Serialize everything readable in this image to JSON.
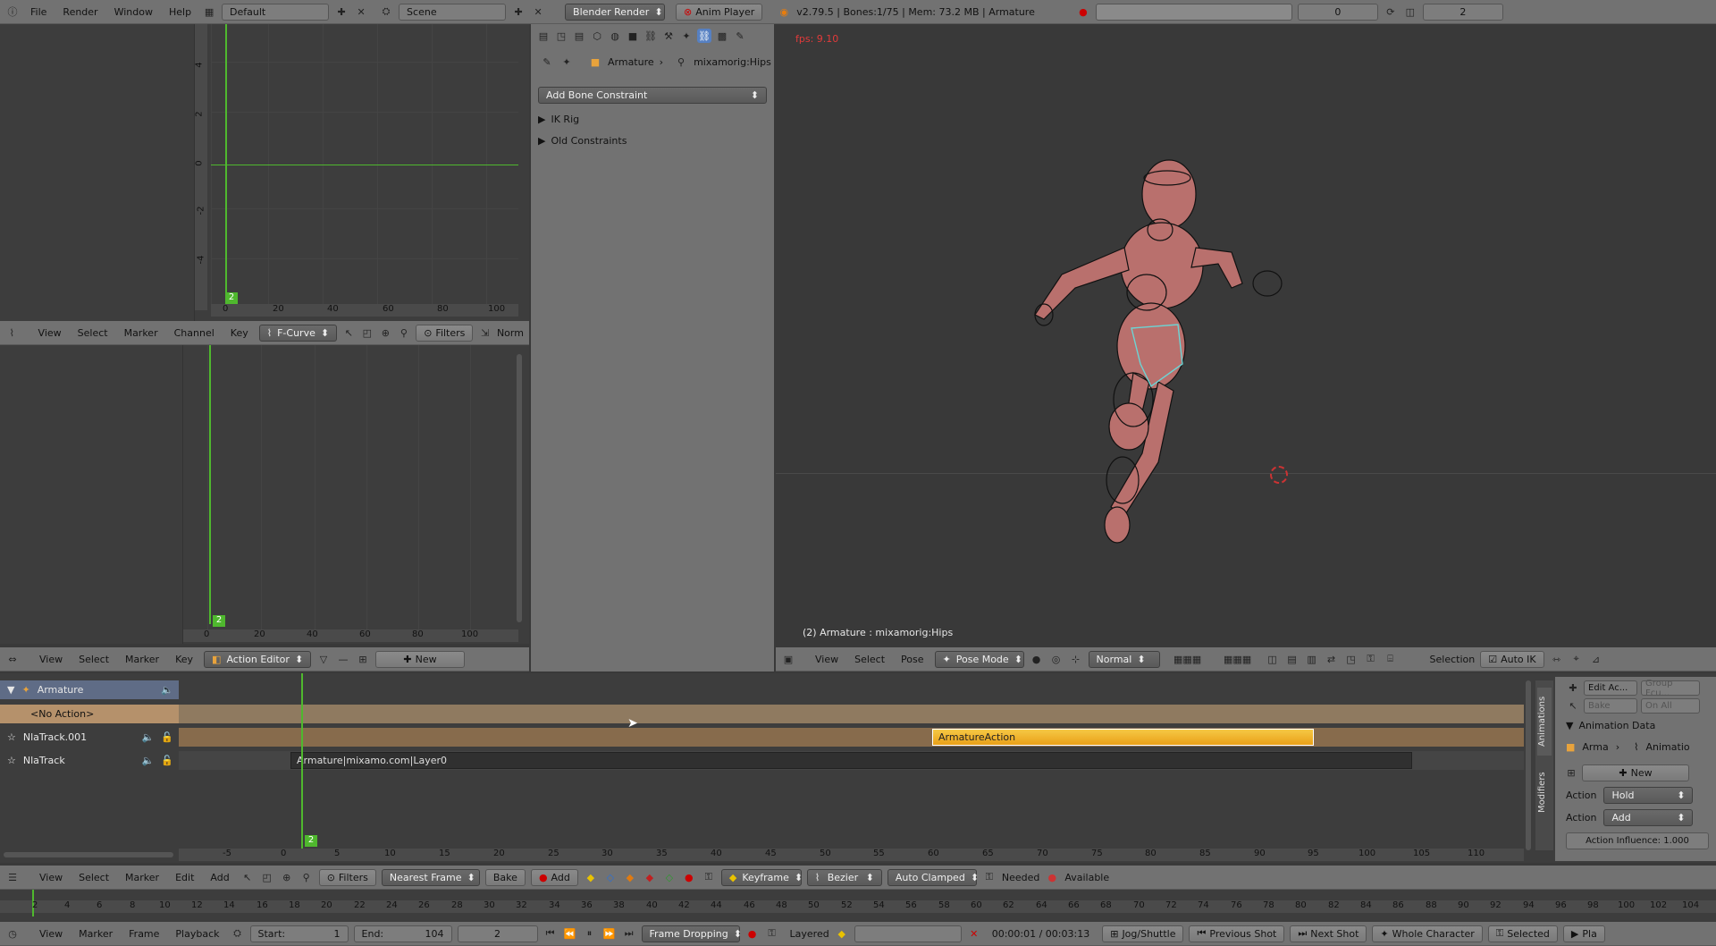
{
  "info_header": {
    "menus": [
      "File",
      "Render",
      "Window",
      "Help"
    ],
    "layout": "Default",
    "scene": "Scene",
    "engine": "Blender Render",
    "anim_player": "Anim Player",
    "stats": "v2.79.5 | Bones:1/75 | Mem: 73.2 MB | Armature",
    "frame_a": "0",
    "frame_b": "2"
  },
  "graph_editor": {
    "menus": [
      "View",
      "Select",
      "Marker",
      "Channel",
      "Key"
    ],
    "mode": "F-Curve",
    "filters": "Filters",
    "normalize": "Norm",
    "y_ticks": [
      "4",
      "2",
      "0",
      "-2",
      "-4"
    ],
    "x_ticks": [
      "0",
      "20",
      "40",
      "60",
      "80",
      "100"
    ],
    "frame_marker": "2"
  },
  "dope_sheet": {
    "menus": [
      "View",
      "Select",
      "Marker",
      "Key"
    ],
    "mode": "Action Editor",
    "new_label": "New",
    "x_ticks": [
      "0",
      "20",
      "40",
      "60",
      "80",
      "100"
    ],
    "frame_marker": "2"
  },
  "properties": {
    "breadcrumb_obj": "Armature",
    "breadcrumb_bone": "mixamorig:Hips",
    "add_constraint": "Add Bone Constraint",
    "panels": [
      "IK Rig",
      "Old Constraints"
    ]
  },
  "viewport": {
    "fps": "fps: 9.10",
    "status": "(2) Armature : mixamorig:Hips",
    "menus": [
      "View",
      "Select",
      "Pose"
    ],
    "mode": "Pose Mode",
    "orientation": "Normal",
    "selection": "Selection",
    "auto_ik": "Auto IK"
  },
  "nla": {
    "channels": [
      {
        "name": "Armature"
      },
      {
        "name": "<No Action>"
      },
      {
        "name": "NlaTrack.001"
      },
      {
        "name": "NlaTrack"
      }
    ],
    "strip_action": "ArmatureAction",
    "strip_layer": "Armature|mixamo.com|Layer0",
    "x_ticks": [
      "-5",
      "0",
      "5",
      "10",
      "15",
      "20",
      "25",
      "30",
      "35",
      "40",
      "45",
      "50",
      "55",
      "60",
      "65",
      "70",
      "75",
      "80",
      "85",
      "90",
      "95",
      "100",
      "105",
      "110"
    ],
    "frame_marker": "2",
    "menus": [
      "View",
      "Select",
      "Marker",
      "Edit",
      "Add"
    ],
    "filters": "Filters",
    "snap": "Nearest Frame",
    "bake": "Bake",
    "add": "Add",
    "keyframe": "Keyframe",
    "interp": "Bezier",
    "handle": "Auto Clamped",
    "needed": "Needed",
    "available": "Available",
    "side_tabs": [
      "Animations",
      "Modifiers"
    ],
    "side": {
      "edit_action": "Edit Ac...",
      "group_fcu": "Group Fcu...",
      "bake": "Bake",
      "on_all": "On All",
      "panel_title": "Animation Data",
      "arma": "Arma",
      "animatio": "Animatio",
      "new": "New",
      "action_label": "Action",
      "hold": "Hold",
      "action_label2": "Action",
      "add": "Add",
      "influence": "Action Influence: 1.000"
    }
  },
  "timeline": {
    "ticks": [
      "2",
      "4",
      "6",
      "8",
      "10",
      "12",
      "14",
      "16",
      "18",
      "20",
      "22",
      "24",
      "26",
      "28",
      "30",
      "32",
      "34",
      "36",
      "38",
      "40",
      "42",
      "44",
      "46",
      "48",
      "50",
      "52",
      "54",
      "56",
      "58",
      "60",
      "62",
      "64",
      "66",
      "68",
      "70",
      "72",
      "74",
      "76",
      "78",
      "80",
      "82",
      "84",
      "86",
      "88",
      "90",
      "92",
      "94",
      "96",
      "98",
      "100",
      "102",
      "104"
    ],
    "menus": [
      "View",
      "Marker",
      "Frame",
      "Playback"
    ],
    "start": "Start:",
    "start_val": "1",
    "end": "End:",
    "end_val": "104",
    "current": "2",
    "sync": "Frame Dropping",
    "layered": "Layered",
    "time": "00:00:01 / 00:03:13",
    "jog": "Jog/Shuttle",
    "prev_shot": "Previous Shot",
    "next_shot": "Next Shot",
    "whole_char": "Whole Character",
    "selected": "Selected",
    "play": "Pla"
  }
}
